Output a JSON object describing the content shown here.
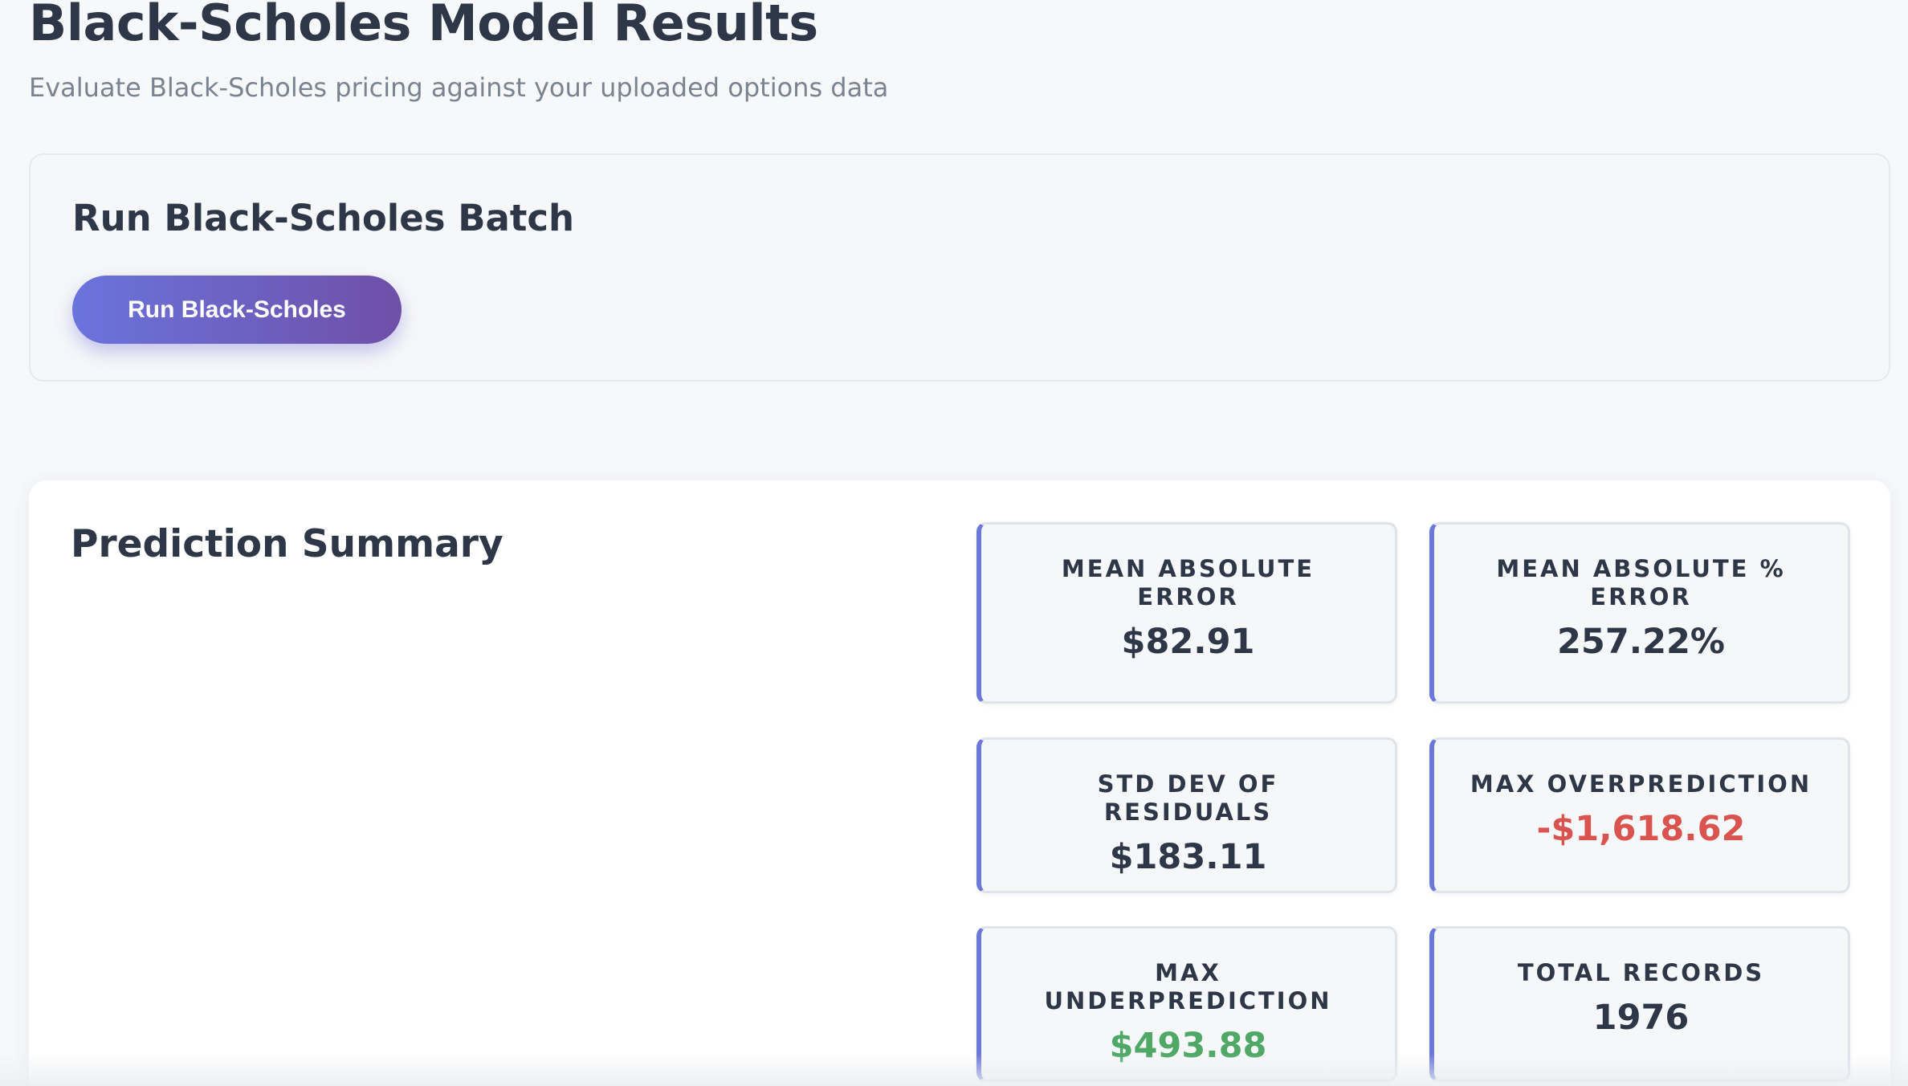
{
  "header": {
    "title": "Black-Scholes Model Results",
    "subtitle": "Evaluate Black-Scholes pricing against your uploaded options data"
  },
  "run_section": {
    "title": "Run Black-Scholes Batch",
    "button_label": "Run Black-Scholes"
  },
  "summary": {
    "title": "Prediction Summary",
    "metrics": [
      {
        "label": "MEAN ABSOLUTE ERROR",
        "value": "$82.91"
      },
      {
        "label": "MEAN ABSOLUTE % ERROR",
        "value": "257.22%"
      },
      {
        "label": "STD DEV OF RESIDUALS",
        "value": "$183.11"
      },
      {
        "label": "MAX OVERPREDICTION",
        "value": "-$1,618.62"
      },
      {
        "label": "MAX UNDERPREDICTION",
        "value": "$493.88"
      },
      {
        "label": "TOTAL RECORDS",
        "value": "1976"
      }
    ]
  },
  "colors": {
    "accent": "#6b78d8",
    "button_gradient_start": "#6a74dc",
    "button_gradient_end": "#6f4fa8",
    "negative": "#d9534f",
    "positive": "#4fa865",
    "text_primary": "#2d3748",
    "text_muted": "#7a8391"
  }
}
